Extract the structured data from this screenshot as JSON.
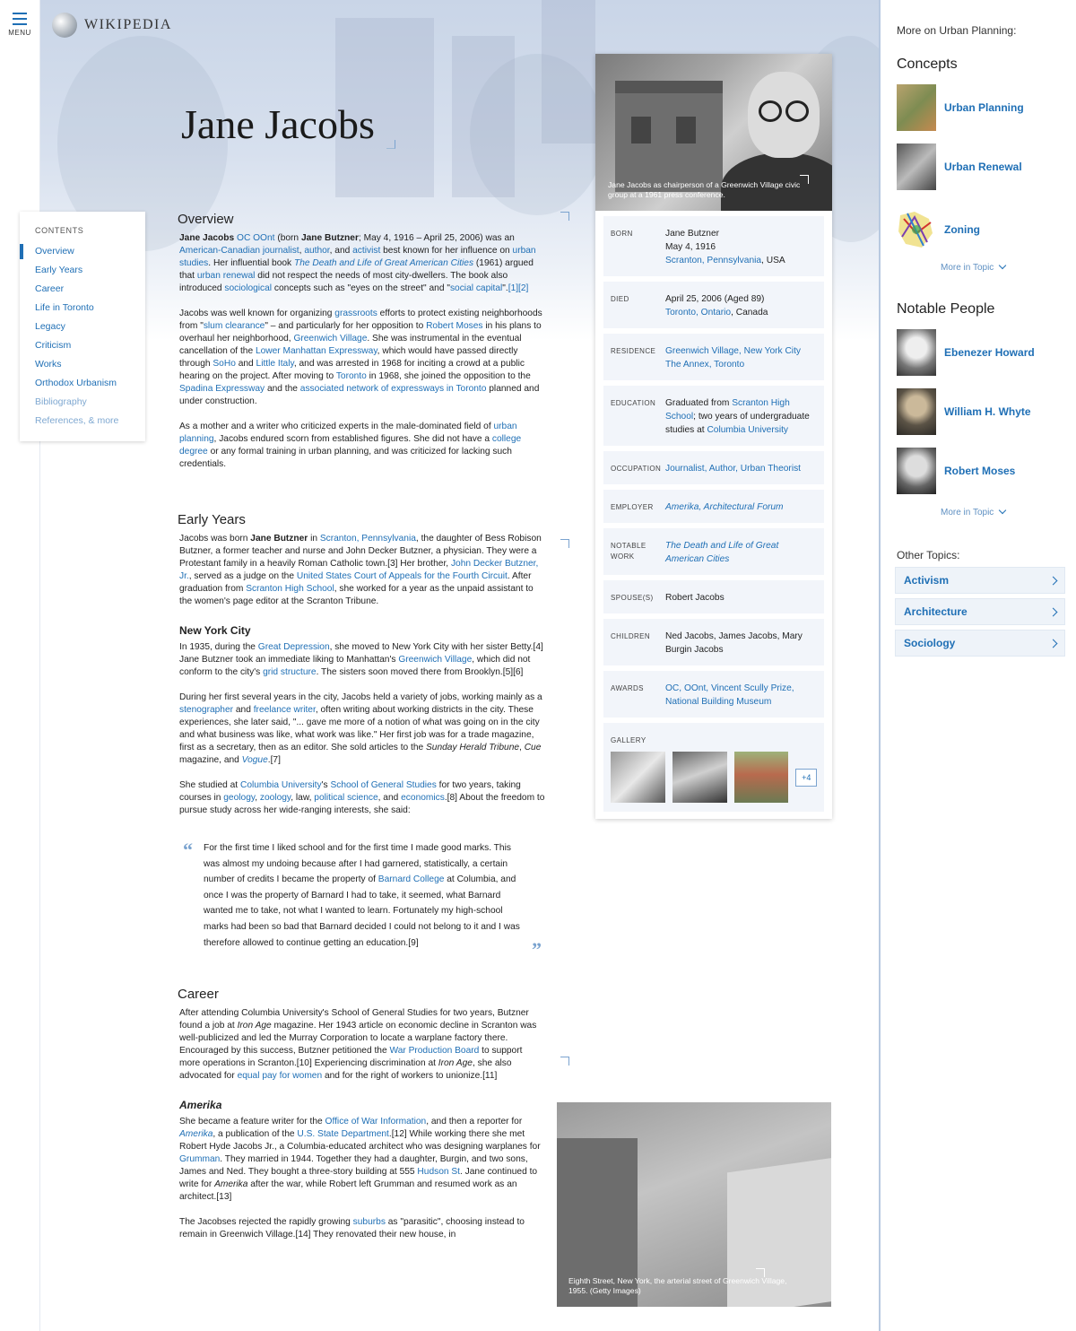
{
  "menu": {
    "label": "MENU"
  },
  "brand": {
    "name": "WIKIPEDIA"
  },
  "title": "Jane Jacobs",
  "toc": {
    "heading": "CONTENTS",
    "items": [
      {
        "label": "Overview"
      },
      {
        "label": "Early Years"
      },
      {
        "label": "Career"
      },
      {
        "label": "Life in Toronto"
      },
      {
        "label": "Legacy"
      },
      {
        "label": "Criticism"
      },
      {
        "label": "Works"
      },
      {
        "label": "Orthodox Urbanism"
      },
      {
        "label": "Bibliography"
      },
      {
        "label": "References, & more"
      }
    ]
  },
  "sections": {
    "overview": {
      "heading": "Overview",
      "p1": [
        {
          "t": "Jane Jacobs",
          "b": true
        },
        {
          "t": " "
        },
        {
          "t": "OC OOnt",
          "l": true
        },
        {
          "t": " (born "
        },
        {
          "t": "Jane Butzner",
          "b": true
        },
        {
          "t": "; May 4, 1916 – April 25, 2006) was an "
        },
        {
          "t": "American-Canadian journalist",
          "l": true
        },
        {
          "t": ", "
        },
        {
          "t": "author",
          "l": true
        },
        {
          "t": ", and "
        },
        {
          "t": "activist",
          "l": true
        },
        {
          "t": " best known for her influence on "
        },
        {
          "t": "urban studies",
          "l": true
        },
        {
          "t": ". Her influential book "
        },
        {
          "t": "The Death and Life of Great American Cities",
          "l": true,
          "i": true
        },
        {
          "t": " (1961) argued that "
        },
        {
          "t": "urban renewal",
          "l": true
        },
        {
          "t": " did not respect the needs of most city-dwellers. The book also introduced "
        },
        {
          "t": "sociological",
          "l": true
        },
        {
          "t": " concepts such as \"eyes on the street\" and \""
        },
        {
          "t": "social capital",
          "l": true
        },
        {
          "t": "\"."
        },
        {
          "t": "[1][2]",
          "l": true
        }
      ],
      "p2": [
        {
          "t": "Jacobs was well known for organizing "
        },
        {
          "t": "grassroots",
          "l": true
        },
        {
          "t": " efforts to protect existing neighborhoods from \""
        },
        {
          "t": "slum clearance",
          "l": true
        },
        {
          "t": "\" – and particularly for her opposition to "
        },
        {
          "t": "Robert Moses",
          "l": true
        },
        {
          "t": " in his plans to overhaul her neighborhood, "
        },
        {
          "t": "Greenwich Village",
          "l": true
        },
        {
          "t": ". She was instrumental in the eventual cancellation of the "
        },
        {
          "t": "Lower Manhattan Expressway",
          "l": true
        },
        {
          "t": ", which would have passed directly through "
        },
        {
          "t": "SoHo",
          "l": true
        },
        {
          "t": " and "
        },
        {
          "t": "Little Italy",
          "l": true
        },
        {
          "t": ", and was arrested in 1968 for inciting a crowd at a public hearing on the project. After moving to "
        },
        {
          "t": "Toronto",
          "l": true
        },
        {
          "t": " in 1968, she joined the opposition to the "
        },
        {
          "t": "Spadina Expressway",
          "l": true
        },
        {
          "t": " and the "
        },
        {
          "t": "associated network of expressways in Toronto",
          "l": true
        },
        {
          "t": " planned and under construction."
        }
      ],
      "p3": [
        {
          "t": "As a mother and a writer who criticized experts in the male-dominated field of "
        },
        {
          "t": "urban planning",
          "l": true
        },
        {
          "t": ", Jacobs endured scorn from established figures. She did not have a "
        },
        {
          "t": "college degree",
          "l": true
        },
        {
          "t": " or any formal training in urban planning, and was criticized for lacking such credentials."
        }
      ]
    },
    "early": {
      "heading": "Early Years",
      "p1": [
        {
          "t": "Jacobs was born "
        },
        {
          "t": "Jane Butzner",
          "b": true
        },
        {
          "t": " in "
        },
        {
          "t": "Scranton, Pennsylvania",
          "l": true
        },
        {
          "t": ", the daughter of Bess Robison Butzner, a former teacher and nurse and John Decker Butzner, a physician. They were a Protestant family in a heavily Roman Catholic town.[3] Her brother, "
        },
        {
          "t": "John Decker Butzner, Jr.",
          "l": true
        },
        {
          "t": ", served as a judge on the "
        },
        {
          "t": "United States Court of Appeals for the Fourth Circuit",
          "l": true
        },
        {
          "t": ". After graduation from "
        },
        {
          "t": "Scranton High School",
          "l": true
        },
        {
          "t": ", she worked for a year as the unpaid assistant to the women's page editor at the Scranton Tribune."
        }
      ],
      "sub": "New York City",
      "p2": [
        {
          "t": "In 1935, during the "
        },
        {
          "t": "Great Depression",
          "l": true
        },
        {
          "t": ", she moved to New York City with her sister Betty.[4] Jane Butzner took an immediate liking to Manhattan's "
        },
        {
          "t": "Greenwich Village",
          "l": true
        },
        {
          "t": ", which did not conform to the city's "
        },
        {
          "t": "grid structure",
          "l": true
        },
        {
          "t": ". The sisters soon moved there from Brooklyn.[5][6]"
        }
      ],
      "p3": [
        {
          "t": "During her first several years in the city, Jacobs held a variety of jobs, working mainly as a "
        },
        {
          "t": "stenographer",
          "l": true
        },
        {
          "t": " and "
        },
        {
          "t": "freelance writer",
          "l": true
        },
        {
          "t": ", often writing about working districts in the city. These experiences, she later said, \"... gave me more of a notion of what was going on in the city and what business was like, what work was like.\" Her first job was for a trade magazine, first as a secretary, then as an editor. She sold articles to the "
        },
        {
          "t": "Sunday Herald Tribune",
          "i": true
        },
        {
          "t": ", "
        },
        {
          "t": "Cue",
          "i": true
        },
        {
          "t": " magazine, and "
        },
        {
          "t": "Vogue",
          "l": true,
          "i": true
        },
        {
          "t": ".[7]"
        }
      ],
      "p4": [
        {
          "t": "She studied at "
        },
        {
          "t": "Columbia University",
          "l": true
        },
        {
          "t": "'s "
        },
        {
          "t": "School of General Studies",
          "l": true
        },
        {
          "t": " for two years, taking courses in "
        },
        {
          "t": "geology",
          "l": true
        },
        {
          "t": ", "
        },
        {
          "t": "zoology",
          "l": true
        },
        {
          "t": ", law, "
        },
        {
          "t": "political science",
          "l": true
        },
        {
          "t": ", and "
        },
        {
          "t": "economics",
          "l": true
        },
        {
          "t": ".[8] About the freedom to pursue study across her wide-ranging interests, she said:"
        }
      ],
      "quote": [
        {
          "t": "For the first time I liked school and for the first time I made good marks. This was almost my undoing because after I had garnered, statistically, a certain number of credits I became the property of "
        },
        {
          "t": "Barnard College",
          "l": true
        },
        {
          "t": " at Columbia, and once I was the property of Barnard I had to take, it seemed, what Barnard wanted me to take, not what I wanted to learn. Fortunately my high-school marks had been so bad that Barnard decided I could not belong to it and I was therefore allowed to continue getting an education.[9]"
        }
      ]
    },
    "career": {
      "heading": "Career",
      "p1": [
        {
          "t": "After attending Columbia University's School of General Studies for two years, Butzner found a job at "
        },
        {
          "t": "Iron Age",
          "i": true
        },
        {
          "t": " magazine. Her 1943 article on economic decline in Scranton was well-publicized and led the Murray Corporation to locate a warplane factory there. Encouraged by this success, Butzner petitioned the "
        },
        {
          "t": "War Production Board",
          "l": true
        },
        {
          "t": " to support more operations in Scranton.[10] Experiencing discrimination at "
        },
        {
          "t": "Iron Age",
          "i": true
        },
        {
          "t": ", she also advocated for "
        },
        {
          "t": "equal pay for women",
          "l": true
        },
        {
          "t": " and for the right of workers to unionize.[11]"
        }
      ],
      "sub": "Amerika",
      "p2": [
        {
          "t": "She became a feature writer for the "
        },
        {
          "t": "Office of War Information",
          "l": true
        },
        {
          "t": ", and then a reporter for "
        },
        {
          "t": "Amerika",
          "l": true,
          "i": true
        },
        {
          "t": ", a publication of the "
        },
        {
          "t": "U.S. State Department",
          "l": true
        },
        {
          "t": ".[12] While working there she met Robert Hyde Jacobs Jr., a Columbia-educated architect who was designing warplanes for "
        },
        {
          "t": "Grumman",
          "l": true
        },
        {
          "t": ". They married in 1944. Together they had a daughter, Burgin, and two sons, James and Ned. They bought a three-story building at 555 "
        },
        {
          "t": "Hudson St",
          "l": true
        },
        {
          "t": ". Jane continued to write for "
        },
        {
          "t": "Amerika",
          "i": true
        },
        {
          "t": " after the war, while Robert left Grumman and resumed work as an architect.[13]"
        }
      ],
      "p3": [
        {
          "t": "The Jacobses rejected the rapidly growing "
        },
        {
          "t": "suburbs",
          "l": true
        },
        {
          "t": " as \"parasitic\", choosing instead to remain in Greenwich Village.[14] They renovated their new house, in"
        }
      ]
    }
  },
  "infobox": {
    "caption": "Jane Jacobs as chairperson of a Greenwich Village civic group at a 1961 press conference.",
    "rows": [
      {
        "label": "BORN",
        "lines": [
          [
            {
              "t": "Jane Butzner"
            }
          ],
          [
            {
              "t": "May 4, 1916"
            }
          ],
          [
            {
              "t": "Scranton, Pennsylvania",
              "l": true
            },
            {
              "t": ", USA"
            }
          ]
        ]
      },
      {
        "label": "DIED",
        "lines": [
          [
            {
              "t": "April 25, 2006 (Aged 89)"
            }
          ],
          [
            {
              "t": "Toronto, Ontario",
              "l": true
            },
            {
              "t": ", Canada"
            }
          ]
        ]
      },
      {
        "label": "RESIDENCE",
        "lines": [
          [
            {
              "t": "Greenwich Village, New York City",
              "l": true
            }
          ],
          [
            {
              "t": "The Annex, Toronto",
              "l": true
            }
          ]
        ]
      },
      {
        "label": "EDUCATION",
        "lines": [
          [
            {
              "t": "Graduated from "
            },
            {
              "t": "Scranton High School",
              "l": true
            },
            {
              "t": "; two years of undergraduate studies at "
            },
            {
              "t": "Columbia University",
              "l": true
            }
          ]
        ]
      },
      {
        "label": "OCCUPATION",
        "lines": [
          [
            {
              "t": "Journalist, Author, Urban Theorist",
              "l": true
            }
          ]
        ]
      },
      {
        "label": "EMPLOYER",
        "lines": [
          [
            {
              "t": "Amerika, Architectural Forum",
              "l": true,
              "i": true
            }
          ]
        ]
      },
      {
        "label": "NOTABLE WORK",
        "lines": [
          [
            {
              "t": "The Death and Life of Great American Cities",
              "l": true,
              "i": true
            }
          ]
        ]
      },
      {
        "label": "SPOUSE(S)",
        "lines": [
          [
            {
              "t": "Robert Jacobs"
            }
          ]
        ]
      },
      {
        "label": "CHILDREN",
        "lines": [
          [
            {
              "t": "Ned Jacobs, James Jacobs, Mary Burgin Jacobs"
            }
          ]
        ]
      },
      {
        "label": "AWARDS",
        "lines": [
          [
            {
              "t": "OC, OOnt, Vincent Scully Prize, National Building Museum",
              "l": true
            }
          ]
        ]
      }
    ],
    "gallery_label": "GALLERY",
    "gallery_more": "+4"
  },
  "street_caption": "Eighth Street, New York, the arterial street of Greenwich Village, 1955. (Getty Images)",
  "sidebar": {
    "intro": "More on Urban Planning:",
    "concepts_heading": "Concepts",
    "concepts": [
      {
        "label": "Urban Planning"
      },
      {
        "label": "Urban Renewal"
      },
      {
        "label": "Zoning"
      }
    ],
    "more_label": "More in Topic",
    "people_heading": "Notable People",
    "people": [
      {
        "label": "Ebenezer Howard"
      },
      {
        "label": "William H. Whyte"
      },
      {
        "label": "Robert Moses"
      }
    ],
    "other_heading": "Other Topics:",
    "other": [
      {
        "label": "Activism"
      },
      {
        "label": "Architecture"
      },
      {
        "label": "Sociology"
      }
    ]
  },
  "colors": {
    "link": "#1f6fb5",
    "accent": "#7aa3cf",
    "infobox_row": "#f2f5fa"
  }
}
